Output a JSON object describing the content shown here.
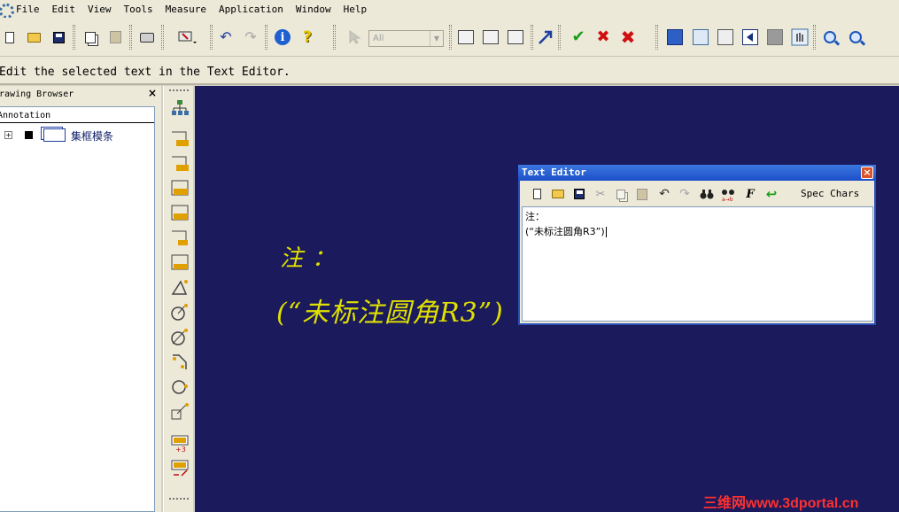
{
  "menu": {
    "items": [
      {
        "label": "File",
        "key": "F"
      },
      {
        "label": "Edit",
        "key": "E"
      },
      {
        "label": "View",
        "key": "V"
      },
      {
        "label": "Tools",
        "key": "T"
      },
      {
        "label": "Measure",
        "key": "M"
      },
      {
        "label": "Application",
        "key": "A"
      },
      {
        "label": "Window",
        "key": "W"
      },
      {
        "label": "Help",
        "key": "H"
      }
    ]
  },
  "toolbar": {
    "filter_combo_value": "All"
  },
  "prompt": {
    "message": "Edit the selected text in the Text Editor."
  },
  "browser": {
    "title": "Drawing Browser",
    "close_glyph": "×",
    "section_header": "Annotation",
    "tree_item_label": "集框模条",
    "expander_glyph": "+"
  },
  "canvas": {
    "note_line1": "注：",
    "note_line2": "(“未标注圆角R3”)",
    "watermark": "三维网www.3dportal.cn"
  },
  "editor": {
    "title": "Text Editor",
    "close_glyph": "×",
    "spec_chars_label": "Spec Chars",
    "text_line1": "注：",
    "text_line2": "(“未标注圆角R3”)"
  },
  "colors": {
    "canvas_bg": "#1a1a5c",
    "note_text": "#e0e000",
    "title_bar": "#2b5fd0",
    "watermark": "#ff3030"
  }
}
